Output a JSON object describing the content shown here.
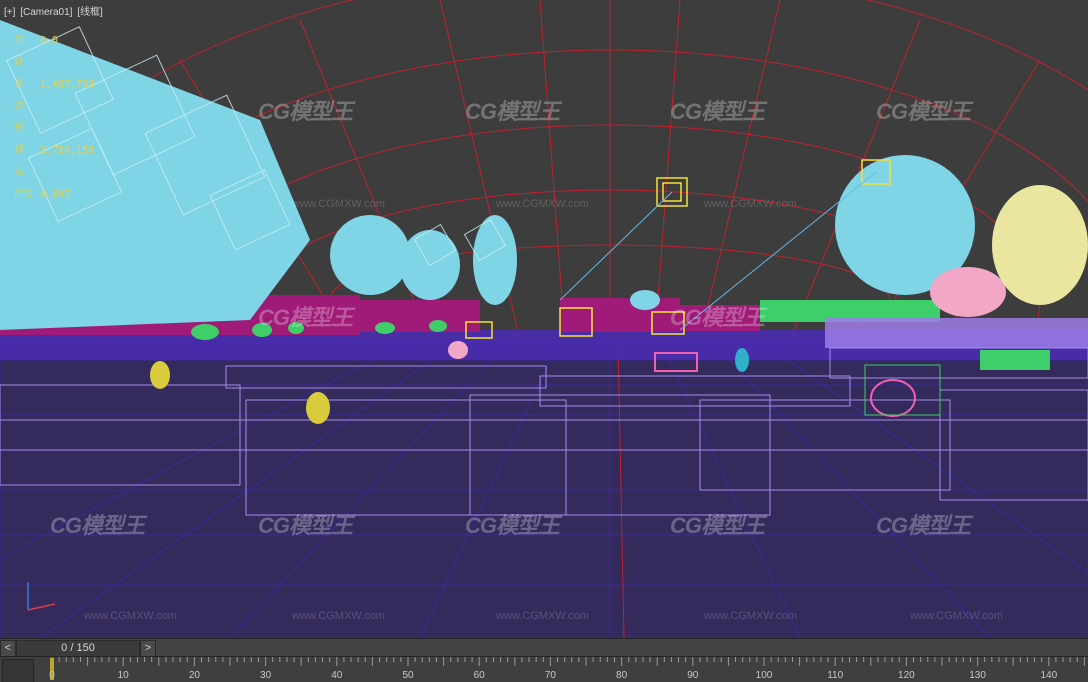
{
  "viewport": {
    "label_parts": [
      "[+]",
      "[Camera01]",
      "[线框]"
    ],
    "stats": [
      {
        "key": "总计",
        "value": "0.0"
      },
      {
        "key": "多边形",
        "value": "1,467,793"
      },
      {
        "key": "顶点",
        "value": "2,720,158"
      },
      {
        "key": "FPS",
        "value": "4.847"
      }
    ],
    "watermark_logo": "CG模型王",
    "watermark_url": "www.CGMXW.com",
    "colors": {
      "background": "#3d3d3d",
      "sky_grid": "#c0222e",
      "ground_grid": "#3a2a9a",
      "trees": "#7fd4e6",
      "shrubs": "#a01a78",
      "field_boxes": "#a68cf0",
      "camera_target": "#f5e23a"
    }
  },
  "timebar": {
    "prev_label": "<",
    "next_label": ">",
    "frame_display": "0 / 150"
  },
  "ruler": {
    "ticks": [
      "0",
      "10",
      "20",
      "30",
      "40",
      "50",
      "60",
      "70",
      "80",
      "90",
      "100",
      "110",
      "120",
      "130",
      "140"
    ]
  }
}
